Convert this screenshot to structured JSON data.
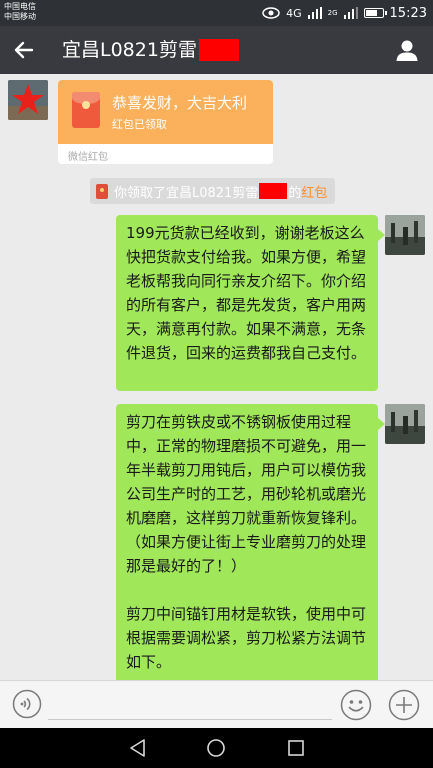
{
  "status": {
    "carrier1": "中国电信",
    "carrier2": "中国移动",
    "signal1": "4G",
    "signal2": "2G",
    "time": "15:23",
    "battery_level": 0.75
  },
  "header": {
    "title": "宜昌L0821剪雷"
  },
  "messages": {
    "hongbao": {
      "title": "恭喜发财，大吉大利",
      "status": "红包已领取",
      "footer": "微信红包"
    },
    "system": {
      "prefix": "你领取了宜昌L0821剪雷",
      "mid": "的",
      "link": "红包"
    },
    "bubble1": "199元货款已经收到，谢谢老板这么快把货款支付给我。如果方便，希望老板帮我向同行亲友介绍下。你介绍的所有客户，都是先发货，客户用两天，满意再付款。如果不满意，无条件退货，回来的运费都我自己支付。",
    "bubble2_p1": "剪刀在剪铁皮或不锈钢板使用过程中，正常的物理磨损不可避免，用一年半载剪刀用钝后，用户可以模仿我公司生产时的工艺，用砂轮机或磨光机磨磨，这样剪刀就重新恢复锋利。（如果方便让街上专业磨剪刀的处理那是最好的了！）",
    "bubble2_p2": "剪刀中间锚钉用材是软铁，使用中可根据需要调松紧，剪刀松紧方法调节如下。"
  },
  "colors": {
    "titlebar": "#393a3f",
    "bubble_green": "#a0e75a",
    "hongbao_orange": "#fbb15b",
    "link_orange": "#ff8f2a",
    "redaction_red": "#ff0000"
  }
}
